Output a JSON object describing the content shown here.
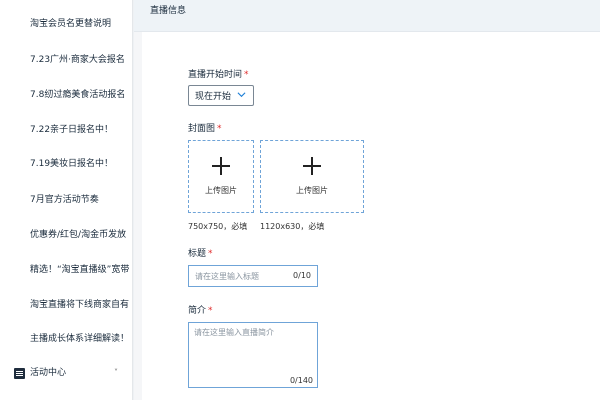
{
  "sidebar": {
    "items": [
      {
        "label": "淘宝会员名更替说明"
      },
      {
        "label": "7.23广州·商家大会报名"
      },
      {
        "label": "7.8纫过瘾美食活动报名"
      },
      {
        "label": "7.22亲子日报名中！"
      },
      {
        "label": "7.19美妆日报名中！"
      },
      {
        "label": "7月官方活动节奏"
      },
      {
        "label": "优惠券/红包/淘金币发放"
      },
      {
        "label": "精选！“淘宝直播级”宽带"
      },
      {
        "label": "淘宝直播将下线商家自有"
      },
      {
        "label": "主播成长体系详细解读！"
      }
    ],
    "section": {
      "label": "活动中心",
      "icon": "list-icon",
      "chevron": "˅"
    }
  },
  "main": {
    "header_title": "直播信息",
    "start_time": {
      "label": "直播开始时间",
      "value": "现在开始"
    },
    "cover": {
      "label": "封面图",
      "upload_label_1": "上传图片",
      "upload_label_2": "上传图片",
      "note_1": "750x750，必填",
      "note_2": "1120x630，必填"
    },
    "title_field": {
      "label": "标题",
      "placeholder": "请在这里输入标题",
      "counter": "0/10"
    },
    "intro_field": {
      "label": "简介",
      "placeholder": "请在这里输入直播简介",
      "counter": "0/140"
    },
    "required_mark": "*"
  },
  "colors": {
    "accent_border": "#6fa4d8",
    "required": "#e02d2d",
    "header_bg": "#eef3f7"
  }
}
